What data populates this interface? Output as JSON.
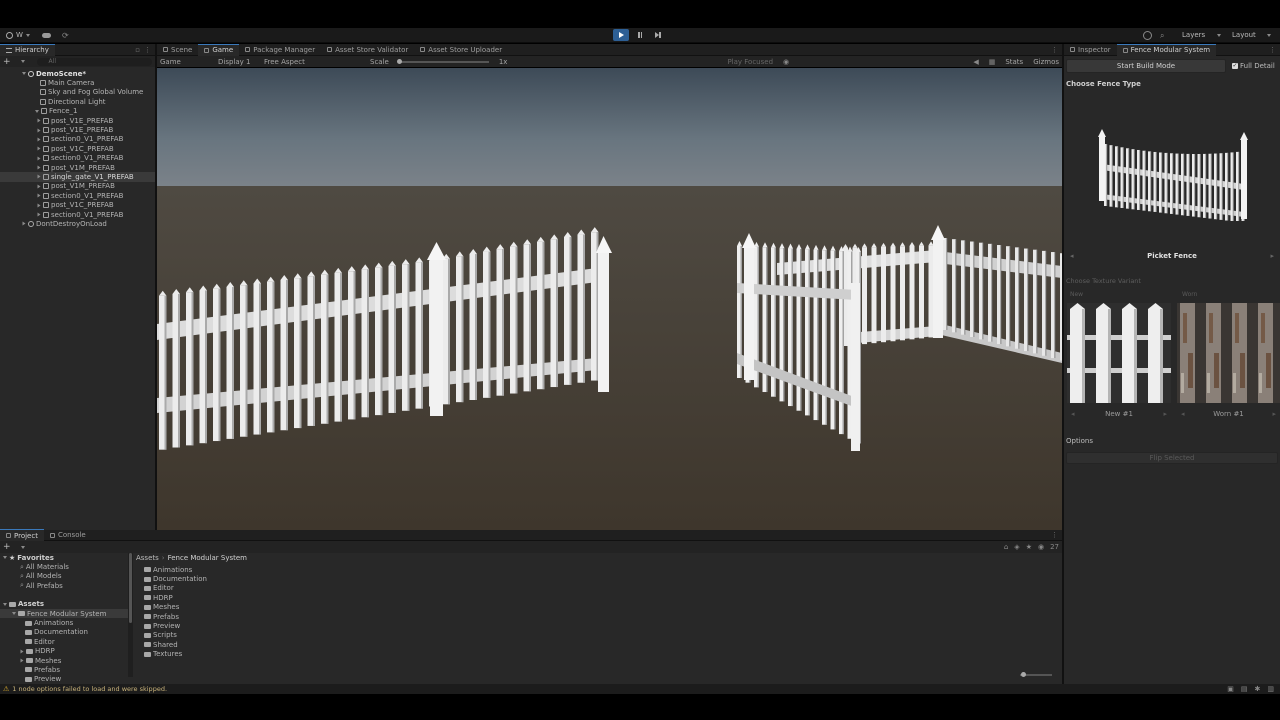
{
  "toolbar": {
    "account": "W",
    "layers": "Layers",
    "layout": "Layout"
  },
  "hierarchy": {
    "tab": "Hierarchy",
    "search_placeholder": "All",
    "scene": "DemoScene*",
    "items": [
      {
        "label": "Main Camera",
        "depth": 1,
        "selected": false
      },
      {
        "label": "Sky and Fog Global Volume",
        "depth": 1,
        "selected": false
      },
      {
        "label": "Directional Light",
        "depth": 1,
        "selected": false
      },
      {
        "label": "Fence_1",
        "depth": 1,
        "selected": false
      },
      {
        "label": "post_V1E_PREFAB",
        "depth": 2,
        "selected": false
      },
      {
        "label": "post_V1E_PREFAB",
        "depth": 2,
        "selected": false
      },
      {
        "label": "section0_V1_PREFAB",
        "depth": 2,
        "selected": false
      },
      {
        "label": "post_V1C_PREFAB",
        "depth": 2,
        "selected": false
      },
      {
        "label": "section0_V1_PREFAB",
        "depth": 2,
        "selected": false
      },
      {
        "label": "post_V1M_PREFAB",
        "depth": 2,
        "selected": false
      },
      {
        "label": "single_gate_V1_PREFAB",
        "depth": 2,
        "selected": true
      },
      {
        "label": "post_V1M_PREFAB",
        "depth": 2,
        "selected": false
      },
      {
        "label": "section0_V1_PREFAB",
        "depth": 2,
        "selected": false
      },
      {
        "label": "post_V1C_PREFAB",
        "depth": 2,
        "selected": false
      },
      {
        "label": "section0_V1_PREFAB",
        "depth": 2,
        "selected": false
      }
    ],
    "dont_destroy": "DontDestroyOnLoad"
  },
  "center_tabs": [
    {
      "label": "Scene",
      "active": false
    },
    {
      "label": "Game",
      "active": true
    },
    {
      "label": "Package Manager",
      "active": false
    },
    {
      "label": "Asset Store Validator",
      "active": false
    },
    {
      "label": "Asset Store Uploader",
      "active": false
    }
  ],
  "game_toolbar": {
    "mode": "Game",
    "display": "Display 1",
    "aspect": "Free Aspect",
    "scale_label": "Scale",
    "scale_value": "1x",
    "play_focused": "Play Focused",
    "stats": "Stats",
    "gizmos": "Gizmos"
  },
  "bottom_tabs": [
    {
      "label": "Project",
      "active": true
    },
    {
      "label": "Console",
      "active": false
    }
  ],
  "project": {
    "favorites_title": "Favorites",
    "favorites": [
      "All Materials",
      "All Models",
      "All Prefabs"
    ],
    "assets_title": "Assets",
    "tree": [
      "Fence Modular System",
      "Animations",
      "Documentation",
      "Editor",
      "HDRP",
      "Meshes",
      "Prefabs",
      "Preview"
    ],
    "breadcrumb": [
      "Assets",
      "Fence Modular System"
    ],
    "folders": [
      "Animations",
      "Documentation",
      "Editor",
      "HDRP",
      "Meshes",
      "Prefabs",
      "Preview",
      "Scripts",
      "Shared",
      "Textures"
    ],
    "count": "27"
  },
  "inspector": {
    "tabs": [
      {
        "label": "Inspector",
        "active": false
      },
      {
        "label": "Fence Modular System",
        "active": true
      }
    ],
    "start_build": "Start Build Mode",
    "full_detail": "Full Detail",
    "choose_fence_type": "Choose Fence Type",
    "fence_name": "Picket Fence",
    "choose_texture": "Choose Texture Variant",
    "variant_headers": [
      "New",
      "Worn"
    ],
    "variants": [
      "New #1",
      "Worn #1"
    ],
    "options": "Options",
    "flip_selected": "Flip Selected"
  },
  "status": {
    "message": "1 node options failed to load and were skipped."
  },
  "colors": {
    "accent": "#3a79bb",
    "panel": "#282828",
    "fence": "#ececec",
    "warning": "#e0b030"
  }
}
